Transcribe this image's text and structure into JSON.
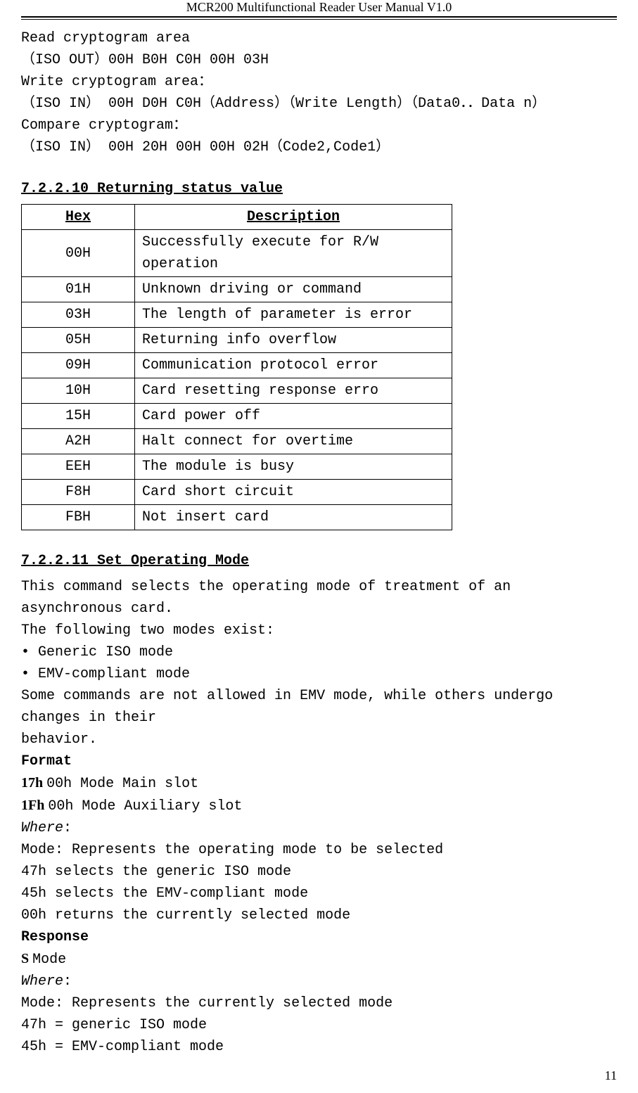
{
  "header": {
    "title": "MCR200 Multifunctional Reader User Manual V1.0"
  },
  "footer": {
    "page_num": "11"
  },
  "top_block": {
    "l1": "Read cryptogram area",
    "l2": "（ISO OUT）00H B0H C0H  00H 03H",
    "l3": "Write cryptogram area：",
    "l4": "（ISO IN）  00H D0H C0H（Address）（Write Length）（Data0．．Data n）",
    "l5": "Compare cryptogram：",
    "l6": "（ISO IN）  00H 20H 00H 00H 02H（Code2,Code1）"
  },
  "chart_data": {
    "type": "table",
    "title": "7.2.2.10 Returning status value",
    "columns": [
      "Hex",
      "Description"
    ],
    "rows": [
      [
        "00H",
        "Successfully execute for R/W operation"
      ],
      [
        "01H",
        "Unknown driving or command"
      ],
      [
        "03H",
        "The length of parameter is error"
      ],
      [
        "05H",
        "Returning info overflow"
      ],
      [
        "09H",
        "Communication protocol error"
      ],
      [
        "10H",
        "Card resetting response erro"
      ],
      [
        "15H",
        "Card power off"
      ],
      [
        "A2H",
        "Halt connect for overtime"
      ],
      [
        "EEH",
        "The module is busy"
      ],
      [
        "F8H",
        "Card short circuit"
      ],
      [
        "FBH",
        "Not insert card"
      ]
    ]
  },
  "section_7_2_2_11": {
    "title": "7.2.2.11 Set Operating Mode",
    "p1": "This command selects the operating mode of treatment of an asynchronous card.",
    "p2": "The following two modes exist:",
    "b1": "• Generic ISO mode",
    "b2": "• EMV-compliant mode",
    "p3": "Some commands are not allowed in EMV mode, while others undergo changes in their",
    "p4": "behavior.",
    "format_label": "Format",
    "f1a": "17h ",
    "f1b": "00h Mode Main slot",
    "f2a": "1Fh ",
    "f2b": "00h Mode Auxiliary slot",
    "where1": "Where",
    "where1_colon": ":",
    "m1": "Mode: Represents the operating mode to be selected",
    "m2": "47h selects the generic ISO mode",
    "m3": "45h selects the EMV-compliant mode",
    "m4": "00h returns the currently selected mode",
    "response_label": "Response",
    "r1a": "S ",
    "r1b": "Mode",
    "where2": "Where",
    "where2_colon": ":",
    "r2": "Mode: Represents the currently selected mode",
    "r3": "47h = generic ISO mode",
    "r4": "45h = EMV-compliant mode"
  }
}
